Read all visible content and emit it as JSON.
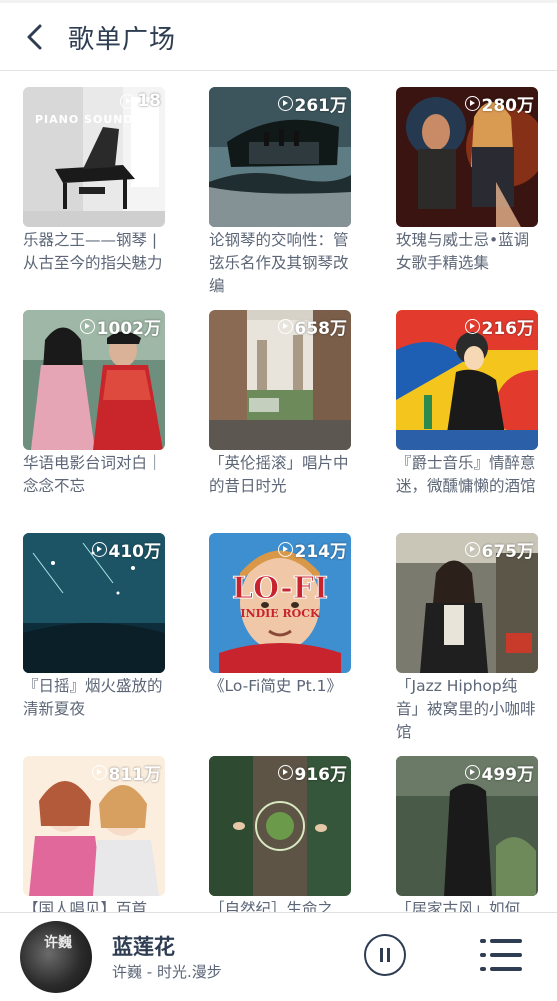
{
  "header": {
    "title": "歌单广场"
  },
  "playlists": [
    {
      "count": "18",
      "caption": "乐器之王——钢琴 | 从古至今的指尖魅力",
      "cover_text": "PIANO SOUNDS"
    },
    {
      "count": "261万",
      "caption": "论钢琴的交响性：管弦乐名作及其钢琴改编"
    },
    {
      "count": "280万",
      "caption": "玫瑰与威士忌•蓝调女歌手精选集"
    },
    {
      "count": "1002万",
      "caption": "华语电影台词对白｜念念不忘"
    },
    {
      "count": "658万",
      "caption": "「英伦摇滚」唱片中的昔日时光"
    },
    {
      "count": "216万",
      "caption": "『爵士音乐』情醉意迷，微醺慵懒的酒馆"
    },
    {
      "count": "410万",
      "caption": "『日摇』烟火盛放的清新夏夜"
    },
    {
      "count": "214万",
      "caption": "《Lo-Fi简史 Pt.1》",
      "cover_text": "LO-FI",
      "cover_subtext": "INDIE ROCK"
    },
    {
      "count": "675万",
      "caption": "「Jazz Hiphop纯音」被窝里的小咖啡馆"
    },
    {
      "count": "811万",
      "caption": "【国人唱见】百首"
    },
    {
      "count": "916万",
      "caption": "［自然纪］生命之"
    },
    {
      "count": "499万",
      "caption": "「居家古风」如何"
    }
  ],
  "player": {
    "song": "蓝莲花",
    "artist": "许巍 - 时光.漫步",
    "disc_text": "许巍"
  },
  "colors": {
    "text_dark": "#2f3d52",
    "caption": "#5c6677"
  }
}
